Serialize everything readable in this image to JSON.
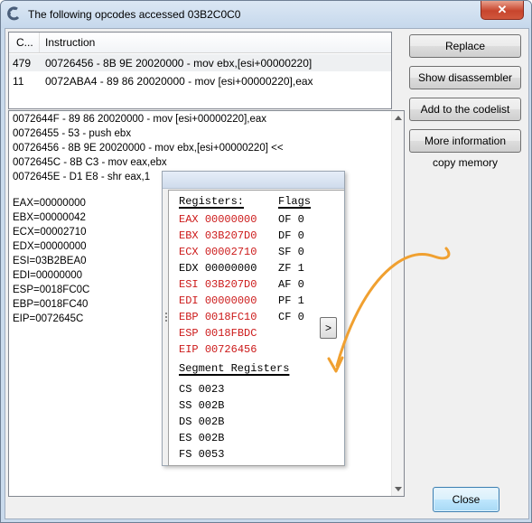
{
  "window": {
    "title": "The following opcodes accessed 03B2C0C0",
    "close_glyph": "✕"
  },
  "list": {
    "columns": [
      "C...",
      "Instruction"
    ],
    "rows": [
      {
        "count": "479",
        "instruction": "00726456 - 8B 9E 20020000  - mov ebx,[esi+00000220]",
        "selected": true
      },
      {
        "count": "11",
        "instruction": "0072ABA4 - 89 86 20020000  - mov [esi+00000220],eax",
        "selected": false
      }
    ]
  },
  "buttons": {
    "replace": "Replace",
    "show_disassembler": "Show disassembler",
    "add_to_codelist": "Add to the codelist",
    "more_information": "More information",
    "copy_memory": "copy memory",
    "close": "Close"
  },
  "info": {
    "code_lines": [
      "0072644F - 89 86 20020000  - mov [esi+00000220],eax",
      "00726455 - 53 - push ebx",
      "00726456 - 8B 9E 20020000  - mov ebx,[esi+00000220] <<",
      "0072645C - 8B C3  - mov eax,ebx",
      "0072645E - D1 E8  - shr eax,1"
    ],
    "register_lines": [
      "EAX=00000000",
      "EBX=00000042",
      "ECX=00002710",
      "EDX=00000000",
      "ESI=03B2BEA0",
      "EDI=00000000",
      "ESP=0018FC0C",
      "EBP=0018FC40",
      "EIP=0072645C"
    ]
  },
  "popup": {
    "registers_header": "Registers:",
    "flags_header": "Flags",
    "segment_header": "Segment Registers",
    "more_button": ">",
    "registers": [
      {
        "name": "EAX",
        "value": "00000000",
        "changed": true
      },
      {
        "name": "EBX",
        "value": "03B207D0",
        "changed": true
      },
      {
        "name": "ECX",
        "value": "00002710",
        "changed": true
      },
      {
        "name": "EDX",
        "value": "00000000",
        "changed": false
      },
      {
        "name": "ESI",
        "value": "03B207D0",
        "changed": true
      },
      {
        "name": "EDI",
        "value": "00000000",
        "changed": true
      },
      {
        "name": "EBP",
        "value": "0018FC10",
        "changed": true
      },
      {
        "name": "ESP",
        "value": "0018FBDC",
        "changed": true
      },
      {
        "name": "EIP",
        "value": "00726456",
        "changed": true
      }
    ],
    "flags": [
      {
        "name": "OF",
        "value": "0"
      },
      {
        "name": "DF",
        "value": "0"
      },
      {
        "name": "SF",
        "value": "0"
      },
      {
        "name": "ZF",
        "value": "1"
      },
      {
        "name": "AF",
        "value": "0"
      },
      {
        "name": "PF",
        "value": "1"
      },
      {
        "name": "CF",
        "value": "0"
      }
    ],
    "segments": [
      {
        "name": "CS",
        "value": "0023"
      },
      {
        "name": "SS",
        "value": "002B"
      },
      {
        "name": "DS",
        "value": "002B"
      },
      {
        "name": "ES",
        "value": "002B"
      },
      {
        "name": "FS",
        "value": "0053"
      }
    ]
  },
  "colors": {
    "changed_register": "#cc1a1a",
    "annotation_arrow": "#f0a030"
  }
}
